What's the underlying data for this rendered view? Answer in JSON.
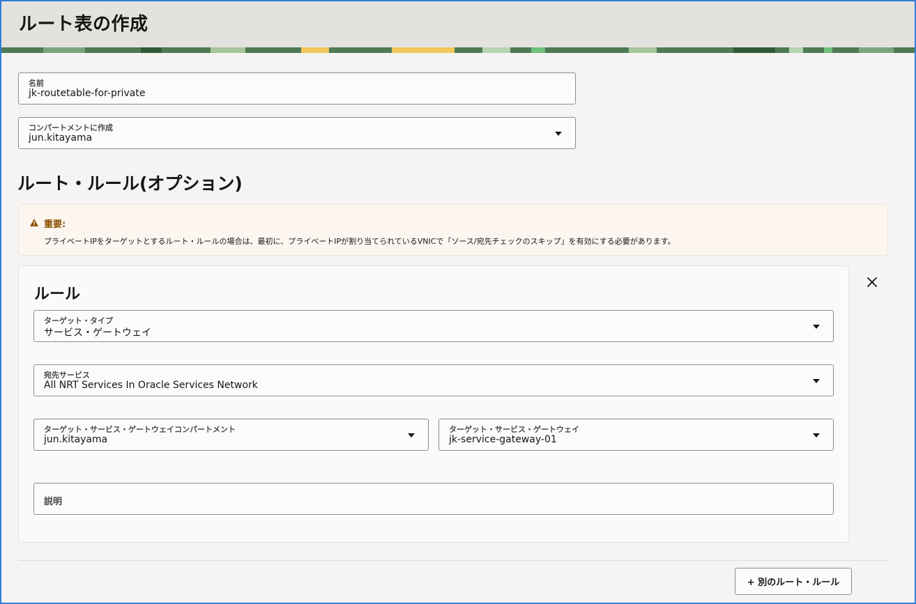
{
  "page": {
    "title": "ルート表の作成"
  },
  "form": {
    "name": {
      "label": "名前",
      "value": "jk-routetable-for-private"
    },
    "compartment": {
      "label": "コンパートメントに作成",
      "value": "jun.kitayama"
    }
  },
  "route_rules": {
    "section_title": "ルート・ルール(オプション)",
    "notice": {
      "icon": "warning-icon",
      "title": "重要:",
      "text": "プライベートIPをターゲットとするルート・ルールの場合は、最初に、プライベートIPが割り当てられているVNICで「ソース/宛先チェックのスキップ」を有効にする必要があります。"
    },
    "rule": {
      "title": "ルール",
      "target_type": {
        "label": "ターゲット・タイプ",
        "value": "サービス・ゲートウェイ"
      },
      "destination_service": {
        "label": "宛先サービス",
        "value": "All NRT Services In Oracle Services Network"
      },
      "target_compartment": {
        "label": "ターゲット・サービス・ゲートウェイコンパートメント",
        "value": "jun.kitayama"
      },
      "target_gateway": {
        "label": "ターゲット・サービス・ゲートウェイ",
        "value": "jk-service-gateway-01"
      },
      "description": {
        "placeholder": "説明",
        "value": ""
      }
    },
    "add_button_label": "+ 別のルート・ルール"
  },
  "colors": {
    "header_bg": "#e4e2de",
    "page_bg": "#f5f4f2",
    "notice_bg": "#fdf6f0",
    "warning": "#8a4f00",
    "banner_green": "#4f7a55"
  }
}
